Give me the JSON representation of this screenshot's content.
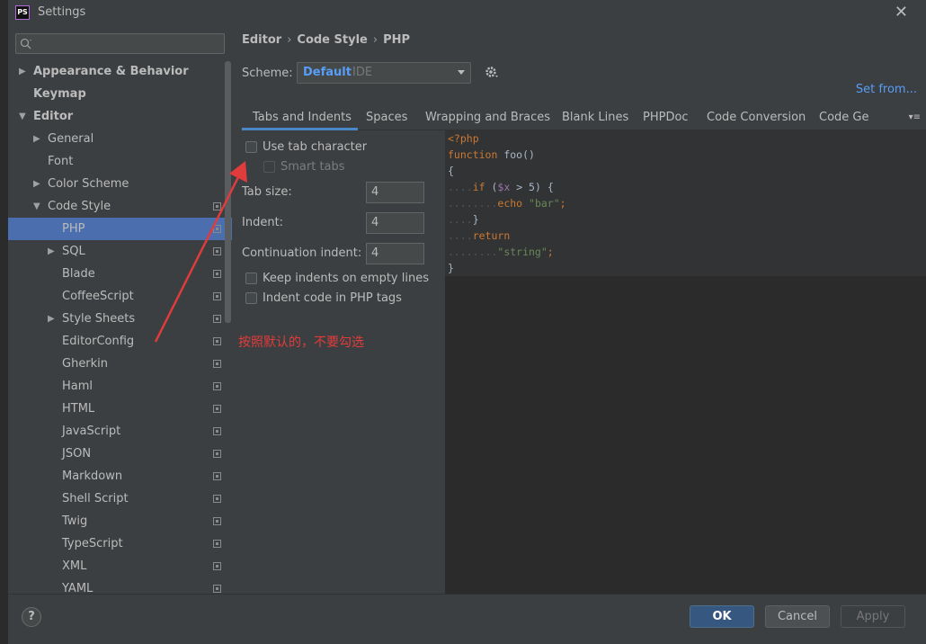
{
  "window": {
    "title": "Settings"
  },
  "search": {
    "placeholder": ""
  },
  "sidebar": {
    "items": [
      {
        "label": "Appearance & Behavior",
        "bold": true,
        "arrow": "▶",
        "indent": 0
      },
      {
        "label": "Keymap",
        "bold": true,
        "arrow": "",
        "indent": 0
      },
      {
        "label": "Editor",
        "bold": true,
        "arrow": "▼",
        "indent": 0
      },
      {
        "label": "General",
        "bold": false,
        "arrow": "▶",
        "indent": 1
      },
      {
        "label": "Font",
        "bold": false,
        "arrow": "",
        "indent": 1
      },
      {
        "label": "Color Scheme",
        "bold": false,
        "arrow": "▶",
        "indent": 1
      },
      {
        "label": "Code Style",
        "bold": false,
        "arrow": "▼",
        "indent": 1
      },
      {
        "label": "PHP",
        "bold": false,
        "arrow": "",
        "indent": 2,
        "selected": true
      },
      {
        "label": "SQL",
        "bold": false,
        "arrow": "▶",
        "indent": 2
      },
      {
        "label": "Blade",
        "bold": false,
        "arrow": "",
        "indent": 2
      },
      {
        "label": "CoffeeScript",
        "bold": false,
        "arrow": "",
        "indent": 2
      },
      {
        "label": "Style Sheets",
        "bold": false,
        "arrow": "▶",
        "indent": 2
      },
      {
        "label": "EditorConfig",
        "bold": false,
        "arrow": "",
        "indent": 2
      },
      {
        "label": "Gherkin",
        "bold": false,
        "arrow": "",
        "indent": 2
      },
      {
        "label": "Haml",
        "bold": false,
        "arrow": "",
        "indent": 2
      },
      {
        "label": "HTML",
        "bold": false,
        "arrow": "",
        "indent": 2
      },
      {
        "label": "JavaScript",
        "bold": false,
        "arrow": "",
        "indent": 2
      },
      {
        "label": "JSON",
        "bold": false,
        "arrow": "",
        "indent": 2
      },
      {
        "label": "Markdown",
        "bold": false,
        "arrow": "",
        "indent": 2
      },
      {
        "label": "Shell Script",
        "bold": false,
        "arrow": "",
        "indent": 2
      },
      {
        "label": "Twig",
        "bold": false,
        "arrow": "",
        "indent": 2
      },
      {
        "label": "TypeScript",
        "bold": false,
        "arrow": "",
        "indent": 2
      },
      {
        "label": "XML",
        "bold": false,
        "arrow": "",
        "indent": 2
      },
      {
        "label": "YAML",
        "bold": false,
        "arrow": "",
        "indent": 2
      }
    ]
  },
  "breadcrumb": {
    "part1": "Editor",
    "part2": "Code Style",
    "part3": "PHP",
    "separator": "›"
  },
  "scheme": {
    "label": "Scheme:",
    "value": "Default",
    "sub": "IDE",
    "set_from": "Set from..."
  },
  "tabs": [
    {
      "label": "Tabs and Indents",
      "active": true
    },
    {
      "label": "Spaces"
    },
    {
      "label": "Wrapping and Braces"
    },
    {
      "label": "Blank Lines"
    },
    {
      "label": "PHPDoc"
    },
    {
      "label": "Code Conversion"
    },
    {
      "label": "Code Ge"
    }
  ],
  "tabs_more": "▾≡",
  "options": {
    "use_tab_character": "Use tab character",
    "smart_tabs": "Smart tabs",
    "tab_size_label": "Tab size:",
    "tab_size_value": "4",
    "indent_label": "Indent:",
    "indent_value": "4",
    "continuation_label": "Continuation indent:",
    "continuation_value": "4",
    "keep_indents": "Keep indents on empty lines",
    "indent_php_tags": "Indent code in PHP tags"
  },
  "preview": {
    "lines": [
      {
        "dots": "",
        "parts": [
          {
            "t": "<?php",
            "c": "kw"
          }
        ]
      },
      {
        "dots": "",
        "parts": [
          {
            "t": "function ",
            "c": "kw"
          },
          {
            "t": "foo()",
            "c": ""
          }
        ]
      },
      {
        "dots": "",
        "parts": [
          {
            "t": "{",
            "c": ""
          }
        ]
      },
      {
        "dots": "....",
        "parts": [
          {
            "t": "if ",
            "c": "kw"
          },
          {
            "t": "(",
            "c": ""
          },
          {
            "t": "$x",
            "c": "var"
          },
          {
            "t": " > 5) {",
            "c": ""
          }
        ]
      },
      {
        "dots": "........",
        "parts": [
          {
            "t": "echo ",
            "c": "kw"
          },
          {
            "t": "\"bar\"",
            "c": "str"
          },
          {
            "t": ";",
            "c": "kw"
          }
        ]
      },
      {
        "dots": "....",
        "parts": [
          {
            "t": "}",
            "c": ""
          }
        ]
      },
      {
        "dots": "....",
        "parts": [
          {
            "t": "return",
            "c": "kw"
          }
        ]
      },
      {
        "dots": "........",
        "parts": [
          {
            "t": "\"string\"",
            "c": "str"
          },
          {
            "t": ";",
            "c": "kw"
          }
        ]
      },
      {
        "dots": "",
        "parts": [
          {
            "t": "}",
            "c": ""
          }
        ]
      }
    ]
  },
  "annotation": "按照默认的，不要勾选",
  "footer": {
    "help": "?",
    "ok": "OK",
    "cancel": "Cancel",
    "apply": "Apply"
  },
  "colors": {
    "accent": "#4b6eaf",
    "link": "#589df6",
    "annotation": "#e03c3c"
  }
}
